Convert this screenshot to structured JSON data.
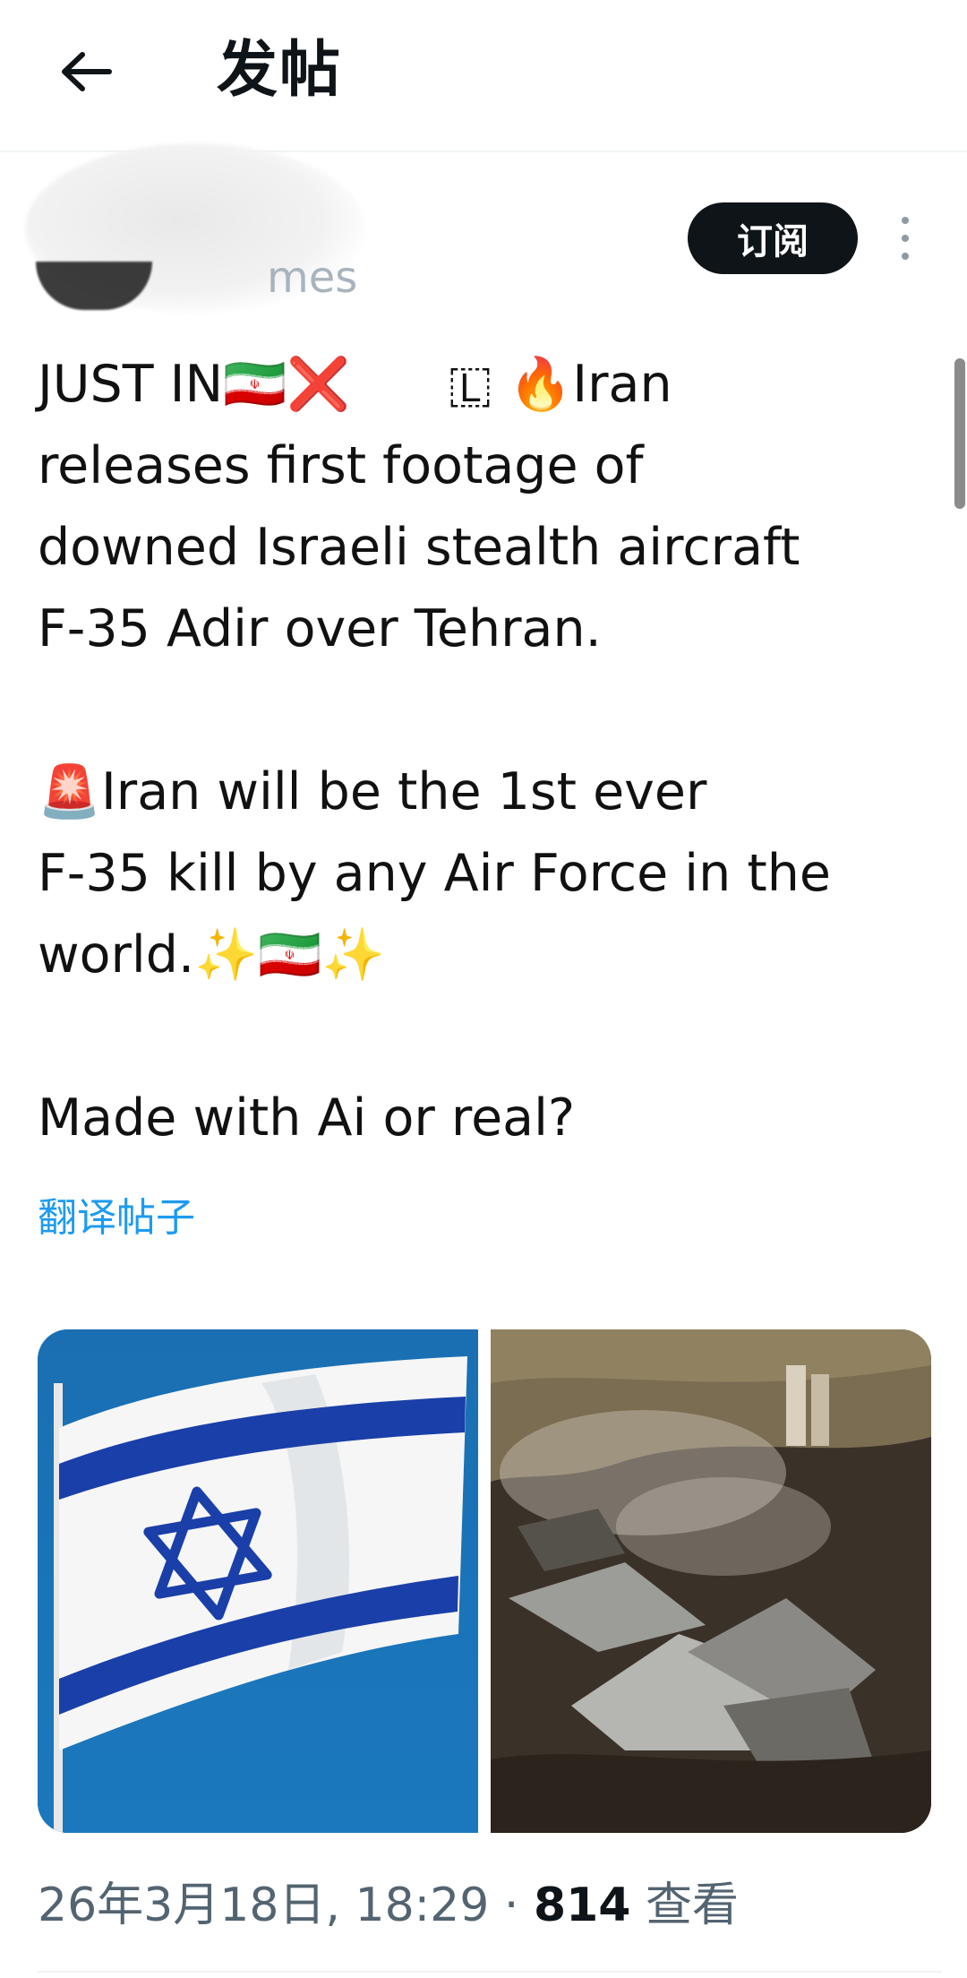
{
  "header": {
    "title": "发帖"
  },
  "post": {
    "handle_visible": "mes",
    "subscribe_label": "订阅",
    "lines": [
      "JUST IN🇮🇷❌      🇱 🔥Iran",
      "releases first footage of",
      "downed Israeli stealth aircraft",
      "F-35 Adir over Tehran.",
      "",
      "🚨Iran will be the 1st ever",
      "F-35 kill by any Air Force in the",
      "world.✨🇮🇷✨",
      "",
      "Made with Ai or real?"
    ],
    "translate_label": "翻译帖子",
    "timestamp": "26年3月18日, 18:29",
    "separator": " · ",
    "views_count": "814",
    "views_label": "查看"
  },
  "colors": {
    "link": "#1d9bf0",
    "subscribe_bg": "#0f1419",
    "muted": "#536471"
  },
  "icons": {
    "back": "arrow-left-icon",
    "more": "more-vertical-icon"
  }
}
